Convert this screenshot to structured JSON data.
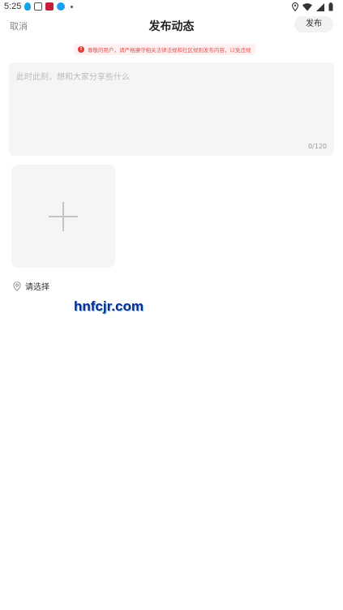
{
  "status_bar": {
    "time": "5:25",
    "notification_icons": [
      "qq-icon",
      "message-icon",
      "app-icon",
      "browser-icon",
      "more-dot-icon"
    ],
    "system_icons": [
      "location-icon",
      "wifi-icon",
      "signal-icon",
      "battery-icon"
    ]
  },
  "header": {
    "cancel_label": "取消",
    "title": "发布动态",
    "publish_label": "发布"
  },
  "notice": {
    "text": "尊敬的用户，请严格遵守相关法律法规和社区规则发布内容，以免违规"
  },
  "compose": {
    "placeholder": "此时此刻，想和大家分享些什么",
    "char_count": "0/120"
  },
  "upload": {
    "icon": "plus-icon"
  },
  "location": {
    "icon": "location-pin-icon",
    "label": "请选择"
  },
  "watermark": {
    "text": "hnfcjr.com"
  },
  "colors": {
    "notice_text": "#e55353",
    "notice_bg": "#fdf0f0",
    "card_bg": "#f5f5f5",
    "watermark": "#0f2a8a"
  }
}
